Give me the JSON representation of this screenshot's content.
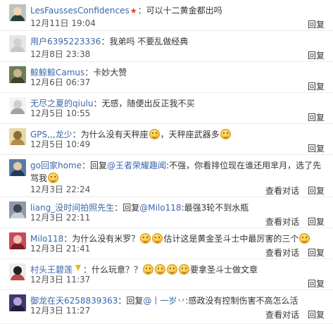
{
  "comments": [
    {
      "user": "LesFaussesConfidences",
      "has_star": true,
      "text": "可以十二黄金都出吗",
      "time": "12月11日 19:04",
      "actions": [
        "回复"
      ],
      "avatar_colors": [
        "#b7c6bf",
        "#f2d3b3",
        "#2b3b3a"
      ]
    },
    {
      "user": "用户6395223336",
      "text": "我弟吗 不要乱做经典",
      "time": "12月8日 23:38",
      "actions": [
        "回复"
      ],
      "avatar_colors": [
        "#e6e6e6",
        "#d2d2d2",
        "#c8c8c8"
      ]
    },
    {
      "user": "鲸鲸鲸Camus",
      "text": "卡妙大赞",
      "time": "12月6日 06:37",
      "actions": [
        "回复"
      ],
      "avatar_colors": [
        "#6d7c5a",
        "#c9b38c",
        "#3a4428"
      ]
    },
    {
      "user": "无尽之夏的qiulu",
      "text": "无感，随便出反正我不买",
      "time": "12月5日 10:55",
      "actions": [
        "回复"
      ],
      "avatar_colors": [
        "#f3f3f3",
        "#cfcfcf",
        "#9aa4aa"
      ]
    },
    {
      "user": "GPS,,,龙少",
      "text_parts": [
        "为什么没有天秤座",
        "emoji",
        "，天秤座武器多",
        "emoji"
      ],
      "time": "12月5日 10:49",
      "actions": [
        "回复"
      ],
      "avatar_colors": [
        "#e7d9a6",
        "#8a6b3b",
        "#b08d48"
      ]
    },
    {
      "user": "go回家home",
      "reply_prefix": "回复",
      "mention": "@王者荣耀趣闻",
      "text_parts": [
        ":不强，你看排位现在谁还用芈月，选了先骂我",
        "emoji"
      ],
      "time": "12月3日 22:24",
      "actions": [
        "查看对话",
        "回复"
      ],
      "avatar_colors": [
        "#5a7aa6",
        "#e4c8a8",
        "#253a5a"
      ]
    },
    {
      "user": "liang_没时间拍照先生",
      "reply_prefix": "回复",
      "mention": "@Milo118",
      "text": ":最强3轮不到水瓶",
      "time": "12月3日 22:11",
      "actions": [
        "查看对话",
        "回复"
      ],
      "avatar_colors": [
        "#8f9aa6",
        "#3b4650",
        "#c7cfd6"
      ]
    },
    {
      "user": "Milo118",
      "text_parts": [
        "为什么没有米罗？",
        "emoji",
        "emoji",
        "估计这是黄金圣斗士中最厉害的三个",
        "emoji"
      ],
      "time": "12月3日 21:41",
      "actions": [
        "查看对话",
        "回复"
      ],
      "avatar_colors": [
        "#c94a59",
        "#f1c4b2",
        "#7a1f2b"
      ]
    },
    {
      "user": "村头王碧莲",
      "has_medal": true,
      "text_parts": [
        "什么玩意？？",
        "emoji",
        "emoji",
        "emoji",
        "emoji",
        "要拿圣斗士做文章"
      ],
      "time": "12月3日 11:37",
      "actions": [
        "回复"
      ],
      "avatar_colors": [
        "#ececec",
        "#222222",
        "#b64a4a"
      ]
    },
    {
      "user": "御龙在天6258839363",
      "reply_prefix": "回复",
      "mention": "@丨一岁丷",
      "text": ":感政没有控制伤害不高怎么活",
      "time": "12月3日 11:27",
      "actions": [
        "查看对话",
        "回复"
      ],
      "avatar_colors": [
        "#3b3b6b",
        "#b9a0d6",
        "#1f1f3a"
      ]
    }
  ]
}
